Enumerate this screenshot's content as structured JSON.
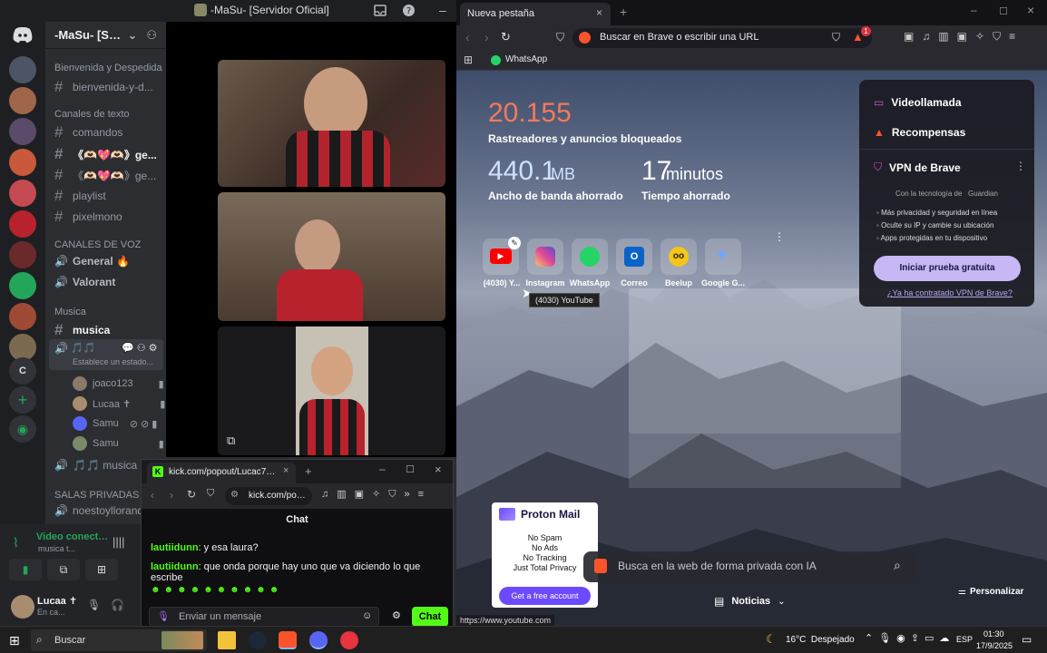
{
  "discord": {
    "window_title": "-MaSu- [Servidor Oficial]",
    "server_name": "-MaSu- [Serv...",
    "categories": {
      "bienvenida": "Bienvenida y Despedida",
      "texto": "Canales de texto",
      "voz": "CANALES DE VOZ",
      "musica": "Musica",
      "privadas": "SALAS PRIVADAS"
    },
    "channels": {
      "bienvenida": "bienvenida-y-d...",
      "comandos": "comandos",
      "ge1": "《🫶🏻💖🫶🏻》ge...",
      "ge2": "《🫶🏻💖🫶🏻》ge...",
      "playlist": "playlist",
      "pixelmono": "pixelmono",
      "general": "General 🔥",
      "valorant": "Valorant",
      "musica": "musica",
      "voice_active": "🎵🎵",
      "voice_status": "Establece un estado...",
      "musica2": "🎵🎵 musica",
      "noestoy": "noestoyllorando"
    },
    "voice_users": [
      "joaco123",
      "Lucaa ✝",
      "Samu",
      "Samu"
    ],
    "server_letter": "C",
    "voice_bar": {
      "status": "Video conectac",
      "sub": "musica t..."
    },
    "user": {
      "name": "Lucaa ✝",
      "status": "En ca..."
    }
  },
  "kick": {
    "tab_title": "kick.com/popout/Lucac77/chat",
    "address": "kick.com/popout",
    "chat_title": "Chat",
    "messages": [
      {
        "user": "lautiidunn",
        "text": ": y esa laura?"
      },
      {
        "user": "lautiidunn",
        "text": ": que onda porque hay uno que va diciendo lo que escribe"
      }
    ],
    "input_placeholder": "Enviar un mensaje",
    "send_label": "Chat"
  },
  "brave": {
    "tab_title": "Nueva pestaña",
    "url_placeholder": "Buscar en Brave o escribir una URL",
    "bookmark": "WhatsApp",
    "notification_count": "1",
    "stats": {
      "trackers_value": "20.155",
      "trackers_label": "Rastreadores y anuncios bloqueados",
      "bandwidth_value": "440.1",
      "bandwidth_unit": "MB",
      "bandwidth_label": "Ancho de banda ahorrado",
      "time_value": "17",
      "time_unit": "minutos",
      "time_label": "Tiempo ahorrado"
    },
    "sites": [
      {
        "label": "(4030) Y..."
      },
      {
        "label": "Instagram"
      },
      {
        "label": "WhatsApp"
      },
      {
        "label": "Correo"
      },
      {
        "label": "Beelup"
      },
      {
        "label": "Google G..."
      }
    ],
    "tooltip": "(4030) YouTube",
    "vpn_card": {
      "videollamada": "Videollamada",
      "recompensas": "Recompensas",
      "vpn_title": "VPN de Brave",
      "powered": "Con la tecnología de",
      "partner": "Guardian",
      "features": [
        "Más privacidad y seguridad en línea",
        "Oculte su IP y cambie su ubicación",
        "Apps protegidas en tu dispositivo"
      ],
      "cta": "Iniciar prueba gratuita",
      "link": "¿Ya ha contratado VPN de Brave?"
    },
    "proton": {
      "brand": "Proton Mail",
      "lines": [
        "No Spam",
        "No Ads",
        "No Tracking",
        "Just Total Privacy"
      ],
      "cta": "Get a free account"
    },
    "search_placeholder": "Busca en la web de forma privada con IA",
    "news_label": "Noticias",
    "customize": "Personalizar",
    "status_url": "https://www.youtube.com"
  },
  "taskbar": {
    "search": "Buscar",
    "weather": "16°C  Despejado",
    "lang": "ESP",
    "time": "01:30",
    "date": "17/9/2025"
  }
}
